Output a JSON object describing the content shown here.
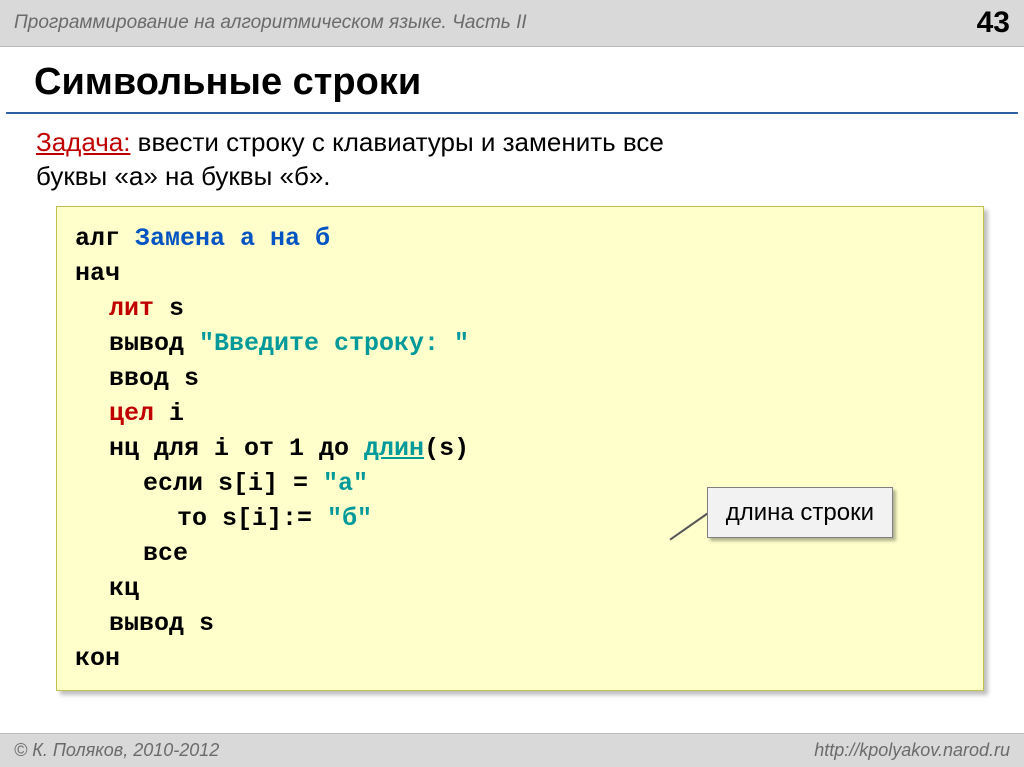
{
  "header": {
    "title": "Программирование на алгоритмическом языке. Часть II",
    "page_number": "43"
  },
  "slide": {
    "title": "Символьные строки"
  },
  "task": {
    "label": "Задача:",
    "line1": " ввести строку с клавиатуры и заменить все",
    "line2": "буквы «а» на буквы «б»."
  },
  "code": {
    "l1_kw": "алг ",
    "l1_name": "Замена а на б",
    "l2": "нач",
    "l3_kw": "лит ",
    "l3_var": "s",
    "l4a": "вывод ",
    "l4_str": "\"Введите строку: \"",
    "l5": "ввод s",
    "l6_kw": "цел ",
    "l6_var": "i",
    "l7a": "нц для i от 1 до ",
    "l7_fn": "длин",
    "l7b": "(s)",
    "l8a": "если s[i] = ",
    "l8_str": "\"а\"",
    "l9a": "то s[i]:= ",
    "l9_str": "\"б\"",
    "l10": "все",
    "l11": "кц",
    "l12": "вывод s",
    "l13": "кон"
  },
  "callout": {
    "text": "длина строки"
  },
  "footer": {
    "copyright": "© К. Поляков, 2010-2012",
    "url": "http://kpolyakov.narod.ru"
  }
}
